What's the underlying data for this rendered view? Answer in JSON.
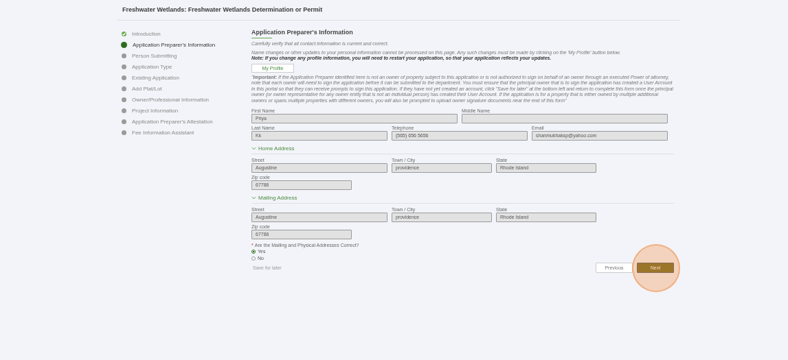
{
  "title": "Freshwater Wetlands: Freshwater Wetlands Determination or Permit",
  "steps": [
    {
      "label": "Introduction",
      "completed": true,
      "selected": false
    },
    {
      "label": "Application Preparer's Information",
      "completed": false,
      "selected": true
    },
    {
      "label": "Person Submitting",
      "completed": false,
      "selected": false
    },
    {
      "label": "Application Type",
      "completed": false,
      "selected": false
    },
    {
      "label": "Existing Application",
      "completed": false,
      "selected": false
    },
    {
      "label": "Add Plat/Lot",
      "completed": false,
      "selected": false
    },
    {
      "label": "Owner/Professional Information",
      "completed": false,
      "selected": false
    },
    {
      "label": "Project Information",
      "completed": false,
      "selected": false
    },
    {
      "label": "Application Preparer's Attestation",
      "completed": false,
      "selected": false
    },
    {
      "label": "Fee Information Assistant",
      "completed": false,
      "selected": false
    }
  ],
  "section": {
    "heading": "Application Preparer's Information",
    "intro": "Carefully verify that all contact information is current and correct.",
    "notice": "Name changes or other updates to your personal information cannot be processed on this page. Any such changes must be made by clicking on the 'My Profile' button below.",
    "note": "Note: If you change any profile information, you will need to restart your application, so that your application reflects your updates.",
    "profile_button": "My Profile",
    "important": "\"**Important:** If the Application Preparer identified here is not an owner of property subject to this application or is not authorized to sign on behalf of an owner through an executed Power of attorney, note that each owner will need to sign the application before it can be submitted to the department. You must ensure that the principal owner that is to sign the application has created a User Account in this portal so that they can receive prompts to sign this application. If they have not yet created an account, click \"Save for later\" at the bottom left and return to  complete this form once the principal owner (or owner representative for any owner entity that is not an individual person) has created their User Account. If the application is for a property that is either owned by multiple additional owners or spans multiple properties with different owners, you will also be prompted to upload owner signature documents near the end of this form\""
  },
  "contact_rows": [
    [
      {
        "label": "First Name",
        "value": "Priya"
      },
      {
        "label": "Middle Name"
      }
    ],
    [
      {
        "label": "Last Name",
        "value": "Kk"
      },
      {
        "label": "Telephone",
        "value": "(565) 656 5656"
      },
      {
        "label": "Email",
        "value": "shanmukhaksp@yahoo.com"
      }
    ]
  ],
  "addresses": [
    {
      "heading": "Home Address",
      "expanded": true,
      "fields": [
        {
          "label": "Street",
          "value": "Augustine"
        },
        {
          "label": "Town / City",
          "value": "providence"
        },
        {
          "label": "State",
          "value": "Rhode Island"
        }
      ],
      "zip": {
        "label": "Zip code",
        "value": "67786"
      }
    },
    {
      "heading": "Mailing Address",
      "expanded": true,
      "fields": [
        {
          "label": "Street",
          "value": "Augustine"
        },
        {
          "label": "Town / City",
          "value": "providence"
        },
        {
          "label": "State",
          "value": "Rhode Island"
        }
      ],
      "zip": {
        "label": "Zip code",
        "value": "67786"
      }
    }
  ],
  "question": {
    "required_mark": "*",
    "label": "Are the Mailing and Physical Addresses Correct?",
    "options": [
      {
        "label": "Yes",
        "selected": true
      },
      {
        "label": "No",
        "selected": false
      }
    ]
  },
  "save_link": "Save for later",
  "previous_button": "Previous",
  "next_button": "Next"
}
